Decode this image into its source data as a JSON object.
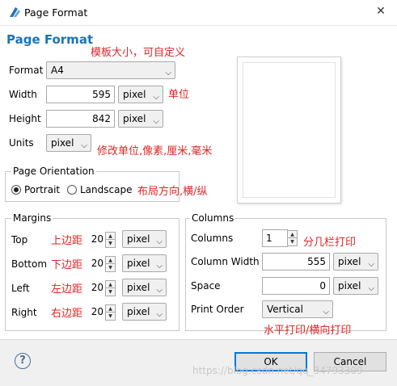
{
  "window": {
    "title": "Page Format"
  },
  "dialog": {
    "heading": "Page Format"
  },
  "annotations": {
    "format": "模板大小，可自定义",
    "unit": "单位",
    "units": "修改单位,像素,厘米,毫米",
    "orientation": "布局方向,横/纵",
    "top": "上边距",
    "bottom": "下边距",
    "left": "左边距",
    "right": "右边距",
    "columns": "分几栏打印",
    "print_order": "水平打印/横向打印"
  },
  "page": {
    "format_label": "Format",
    "format_value": "A4",
    "width_label": "Width",
    "width_value": "595",
    "width_unit": "pixel",
    "height_label": "Height",
    "height_value": "842",
    "height_unit": "pixel",
    "units_label": "Units",
    "units_value": "pixel"
  },
  "orientation": {
    "title": "Page Orientation",
    "portrait": "Portrait",
    "landscape": "Landscape",
    "selected": "portrait"
  },
  "margins": {
    "title": "Margins",
    "top_label": "Top",
    "top_value": "20",
    "top_unit": "pixel",
    "bottom_label": "Bottom",
    "bottom_value": "20",
    "bottom_unit": "pixel",
    "left_label": "Left",
    "left_value": "20",
    "left_unit": "pixel",
    "right_label": "Right",
    "right_value": "20",
    "right_unit": "pixel"
  },
  "columns": {
    "title": "Columns",
    "columns_label": "Columns",
    "columns_value": "1",
    "width_label": "Column Width",
    "width_value": "555",
    "width_unit": "pixel",
    "space_label": "Space",
    "space_value": "0",
    "space_unit": "pixel",
    "order_label": "Print Order",
    "order_value": "Vertical"
  },
  "footer": {
    "help": "?",
    "ok": "OK",
    "cancel": "Cancel",
    "watermark": "https://blog.csdn.net/qq_34793309"
  },
  "colors": {
    "heading": "#1a74b8",
    "annotation": "#e02424",
    "default_button_border": "#0078d7"
  }
}
